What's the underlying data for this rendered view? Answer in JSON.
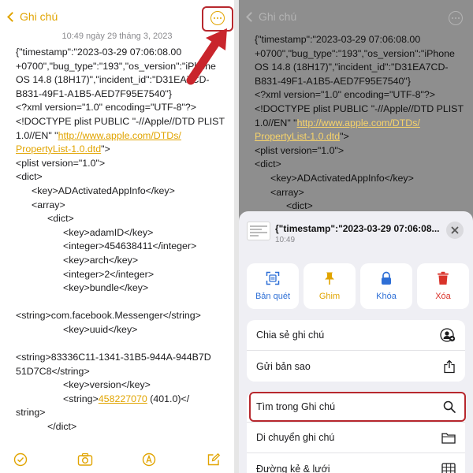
{
  "left": {
    "nav": {
      "back_label": "Ghi chú"
    },
    "date": "10:49 ngày 29 tháng 3, 2023",
    "lines": [
      "{\"timestamp\":\"2023-03-29 07:06:08.00",
      "+0700\",\"bug_type\":\"193\",\"os_version\":\"iPhone",
      "OS 14.8 (18H17)\",\"incident_id\":\"D31EA7CD-",
      "B831-49F1-A1B5-AED7F95E7540\"}",
      "<?xml version=\"1.0\" encoding=\"UTF-8\"?>",
      "<!DOCTYPE plist PUBLIC \"-//Apple//DTD PLIST",
      "1.0//EN\" \"",
      "\">",
      "<plist version=\"1.0\">",
      "<dict>",
      "<key>ADActivatedAppInfo</key>",
      "<array>",
      "<dict>",
      "<key>adamID</key>",
      "<integer>454638411</integer>",
      "<key>arch</key>",
      "<integer>2</integer>",
      "<key>bundle</key>",
      "<string>com.facebook.Messenger</string>",
      "<key>uuid</key>",
      "<string>83336C11-1341-31B5-944A-944B7D",
      "51D7C8</string>",
      "<key>version</key>",
      "<string>",
      " (401.0)</",
      "string>",
      "</dict>"
    ],
    "link1": "http://www.apple.com/DTDs/",
    "link2": "PropertyList-1.0.dtd",
    "link3": "458227070"
  },
  "right": {
    "nav": {
      "back_label": "Ghi chú"
    },
    "lines": [
      "{\"timestamp\":\"2023-03-29 07:06:08.00",
      "+0700\",\"bug_type\":\"193\",\"os_version\":\"iPhone",
      "OS 14.8 (18H17)\",\"incident_id\":\"D31EA7CD-",
      "B831-49F1-A1B5-AED7F95E7540\"}",
      "<?xml version=\"1.0\" encoding=\"UTF-8\"?>",
      "<!DOCTYPE plist PUBLIC \"-//Apple//DTD PLIST",
      "1.0//EN\" \"",
      "\">",
      "<plist version=\"1.0\">",
      "<dict>",
      "<key>ADActivatedAppInfo</key>",
      "<array>",
      "<dict>"
    ],
    "sheet": {
      "title": "{\"timestamp\":\"2023-03-29 07:06:08...",
      "subtitle": "10:49",
      "actions": [
        {
          "label": "Bản quét",
          "icon": "scan-icon"
        },
        {
          "label": "Ghim",
          "icon": "pin-icon"
        },
        {
          "label": "Khóa",
          "icon": "lock-icon"
        },
        {
          "label": "Xóa",
          "icon": "trash-icon"
        }
      ],
      "group1": [
        {
          "label": "Chia sẻ ghi chú",
          "icon": "person-share-icon"
        },
        {
          "label": "Gửi bản sao",
          "icon": "share-icon"
        }
      ],
      "group2": [
        {
          "label": "Tìm trong Ghi chú",
          "icon": "search-icon"
        },
        {
          "label": "Di chuyển ghi chú",
          "icon": "folder-icon"
        },
        {
          "label": "Đường kẻ & lưới",
          "icon": "grid-icon"
        }
      ]
    }
  },
  "colors": {
    "accent": "#e1a400",
    "highlight": "#b7282e",
    "blue": "#2e6fd6",
    "red": "#d9332a"
  }
}
